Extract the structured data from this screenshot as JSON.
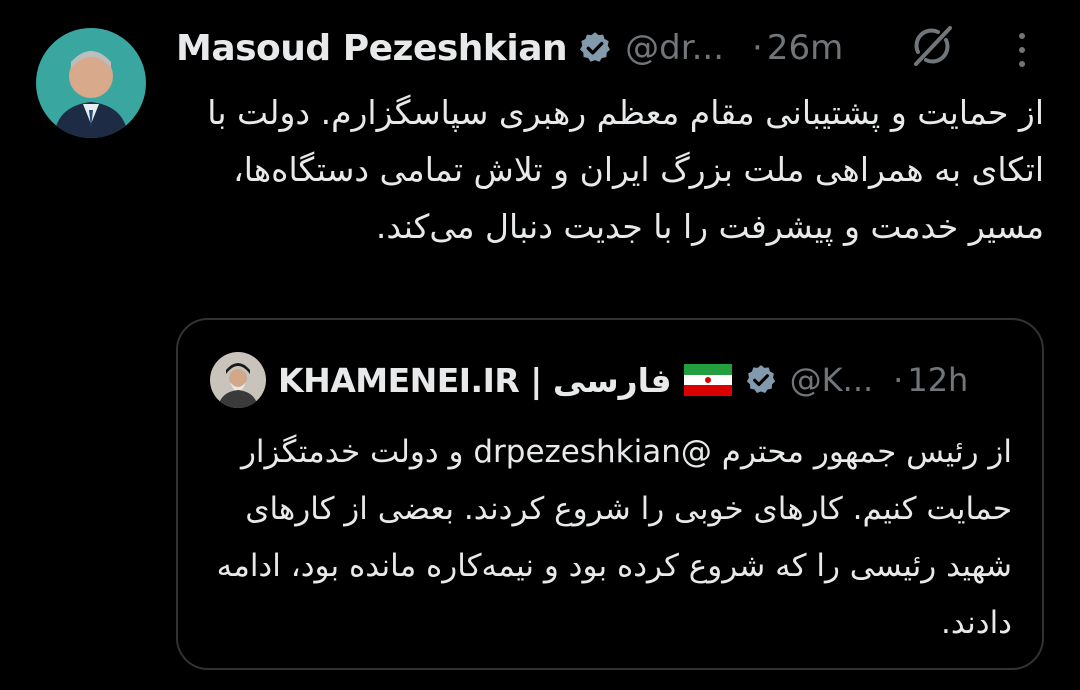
{
  "tweet": {
    "author": {
      "display_name": "Masoud Pezeshkian",
      "handle": "@dr...",
      "verified": true,
      "avatar": "person-portrait"
    },
    "separator": "·",
    "time": "26m",
    "grok_icon": "grok-icon",
    "more_icon": "vertical-ellipsis-icon",
    "text": "از حمایت و پشتیبانی مقام معظم رهبری سپاسگزارم. دولت با اتکای به همراهی ملت بزرگ ایران و تلاش تمامی دستگاه‌ها، مسیر خدمت و پیشرفت را با جدیت دنبال می‌کند."
  },
  "quoted_tweet": {
    "author": {
      "display_name": "KHAMENEI.IR | فارسی",
      "flag": "iran-flag",
      "handle": "@K...",
      "verified": true,
      "avatar": "person-portrait"
    },
    "separator": "·",
    "time": "12h",
    "text": "از رئیس جمهور محترم @drpezeshkian  و دولت خدمتگزار حمایت کنیم. کارهای خوبی را شروع کردند. بعضی از کارهای شهید رئیسی را که شروع کرده بود و نیمه‌کاره مانده بود، ادامه دادند."
  },
  "colors": {
    "background": "#000000",
    "primary_text": "#e7e9ea",
    "secondary_text": "#71767b",
    "border": "#2f3336",
    "verified_badge": "#829aab"
  }
}
